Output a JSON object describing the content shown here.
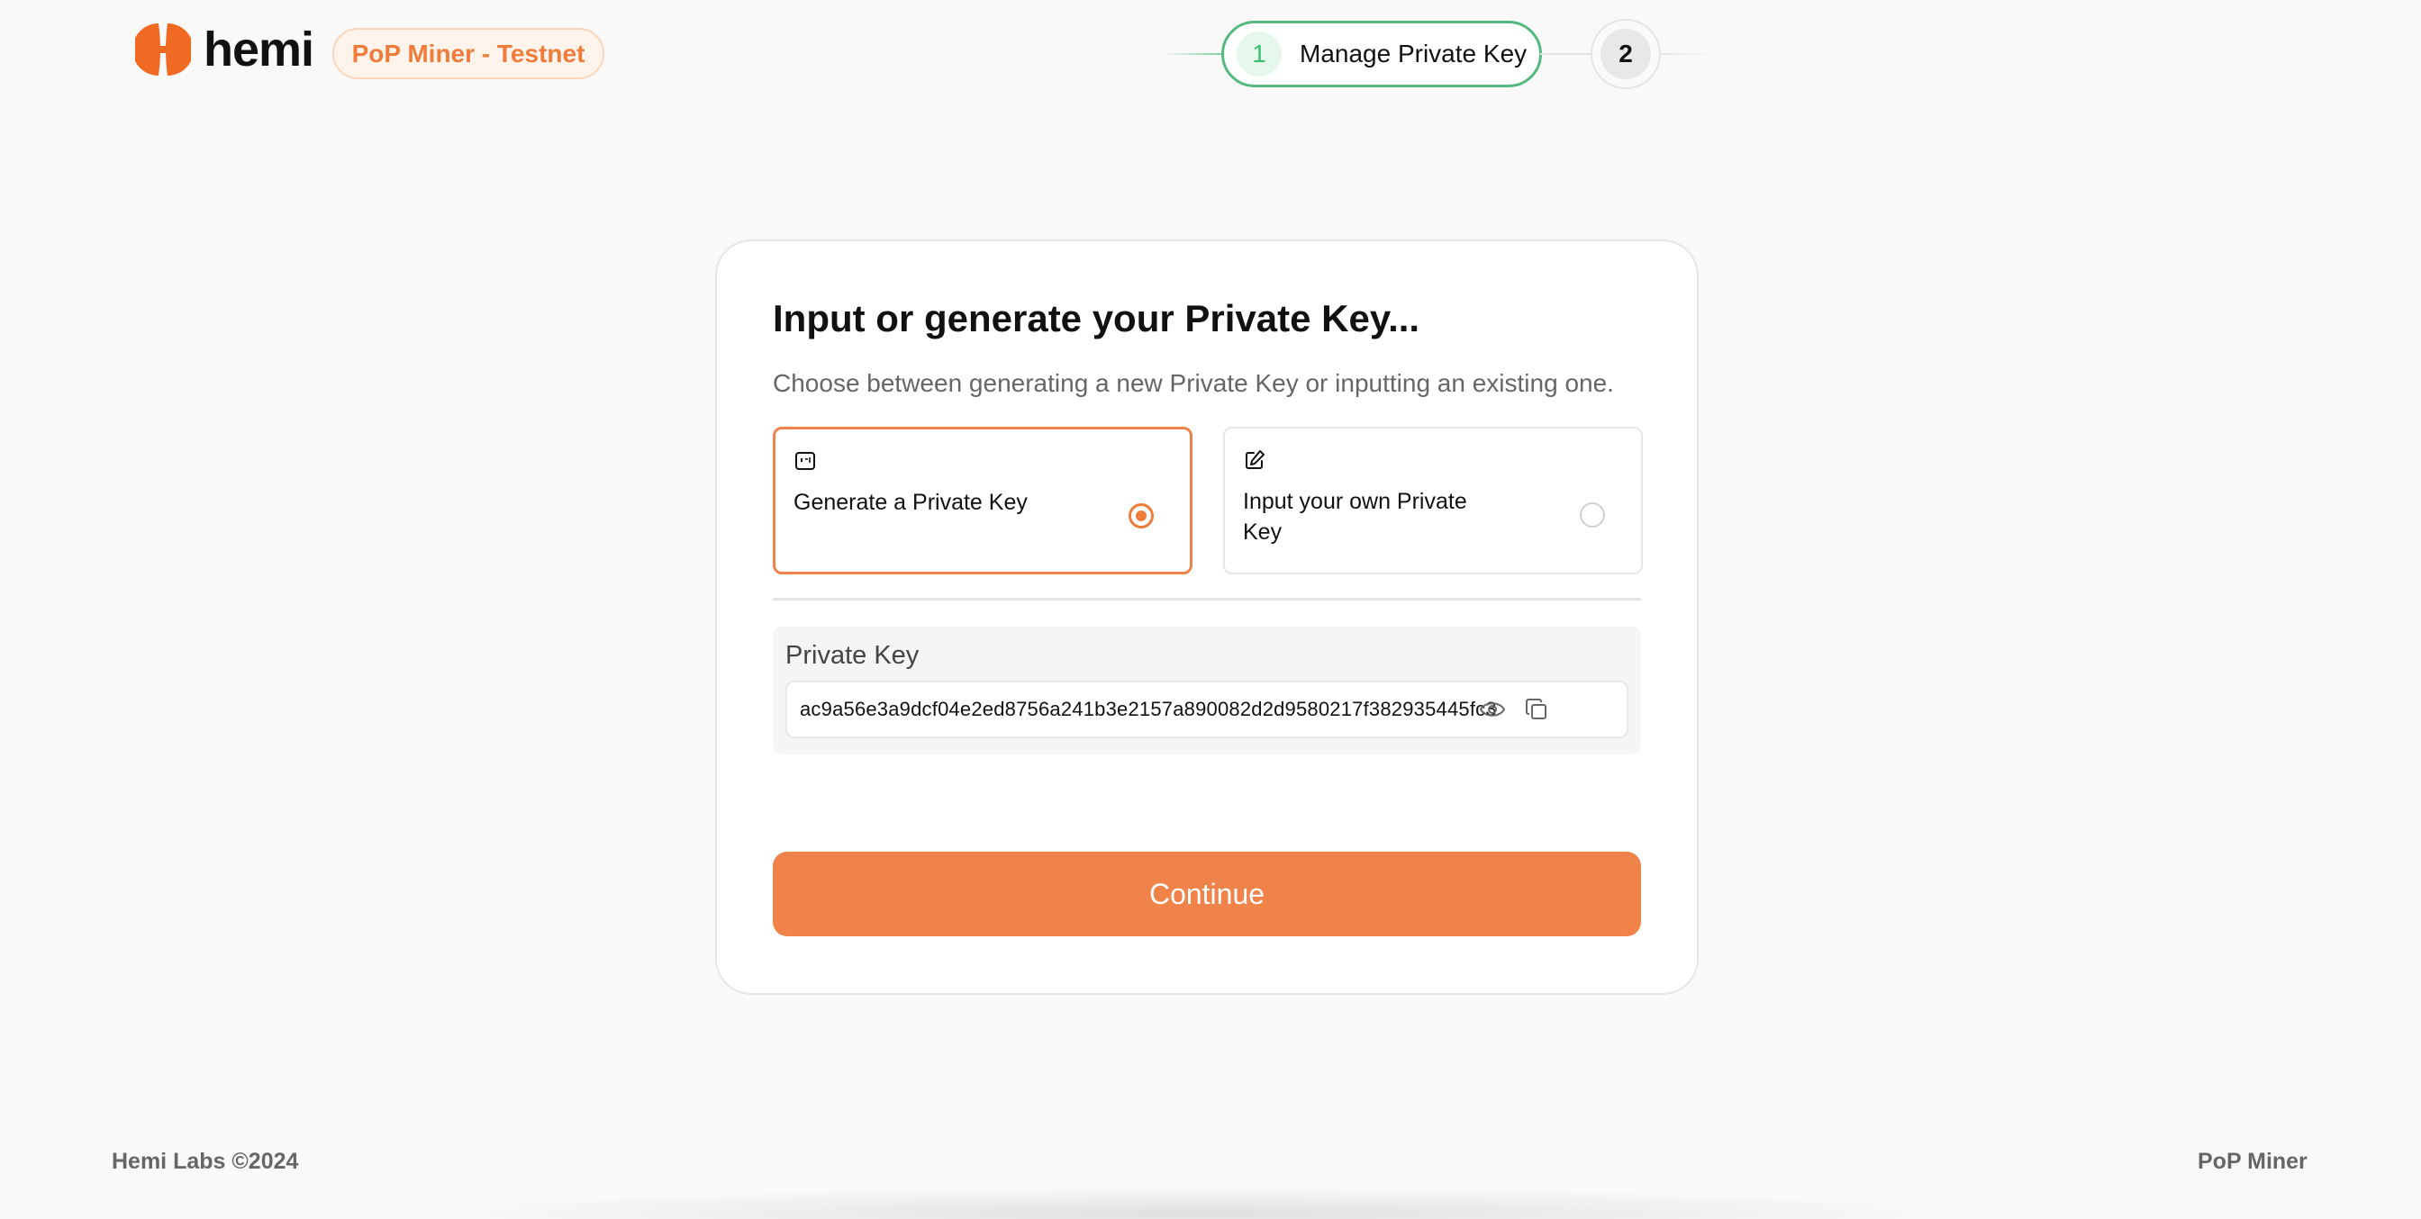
{
  "header": {
    "logo_text": "hemi",
    "env_badge": "PoP Miner - Testnet"
  },
  "stepper": {
    "steps": [
      {
        "number": "1",
        "label": "Manage Private Key",
        "state": "active"
      },
      {
        "number": "2",
        "label": "",
        "state": "pending"
      }
    ]
  },
  "card": {
    "title": "Input or generate your Private Key...",
    "subtitle": "Choose between generating a new Private Key or inputting an existing one.",
    "options": [
      {
        "label": "Generate a Private Key",
        "selected": true,
        "icon": "key-generator-icon"
      },
      {
        "label": "Input your own Private Key",
        "selected": false,
        "icon": "edit-icon"
      }
    ],
    "private_key": {
      "label": "Private Key",
      "value": "ac9a56e3a9dcf04e2ed8756a241b3e2157a890082d2d9580217f382935445fc3"
    },
    "continue_label": "Continue"
  },
  "footer": {
    "left": "Hemi Labs ©2024",
    "right": "PoP Miner"
  },
  "colors": {
    "accent": "#f0834a",
    "success": "#55b981",
    "background": "#f9f9f9"
  }
}
